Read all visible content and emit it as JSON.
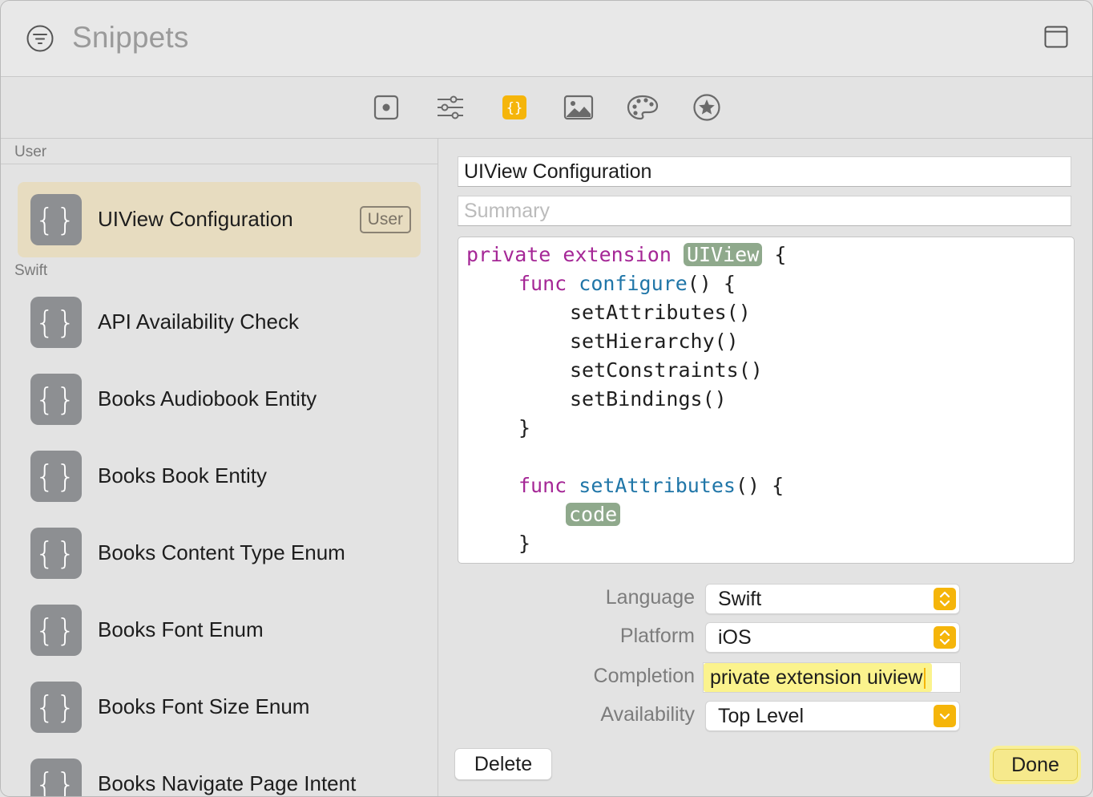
{
  "window": {
    "title": "Snippets"
  },
  "toolbar": {
    "tools": [
      {
        "icon": "record-icon",
        "active": false
      },
      {
        "icon": "sliders-icon",
        "active": false
      },
      {
        "icon": "braces-icon",
        "active": true
      },
      {
        "icon": "image-icon",
        "active": false
      },
      {
        "icon": "palette-icon",
        "active": false
      },
      {
        "icon": "star-icon",
        "active": false
      }
    ],
    "accent_color": "#f5b50a"
  },
  "sidebar": {
    "sections": [
      {
        "label": "User",
        "items": [
          {
            "label": "UIView Configuration",
            "badge": "User",
            "selected": true
          }
        ]
      },
      {
        "label": "Swift",
        "items": [
          {
            "label": "API Availability Check"
          },
          {
            "label": "Books Audiobook Entity"
          },
          {
            "label": "Books Book Entity"
          },
          {
            "label": "Books Content Type Enum"
          },
          {
            "label": "Books Font Enum"
          },
          {
            "label": "Books Font Size Enum"
          },
          {
            "label": "Books Navigate Page Intent"
          }
        ]
      }
    ],
    "icon_glyph": "{}",
    "selection_color": "#e7dcc0"
  },
  "detail": {
    "title_value": "UIView Configuration",
    "summary_placeholder": "Summary",
    "code": {
      "line1": {
        "kw1": "private",
        "kw2": "extension",
        "token": "UIView",
        "rest": " {"
      },
      "line2": {
        "kw": "func",
        "fn": "configure",
        "rest": "() {"
      },
      "line3": "setAttributes()",
      "line4": "setHierarchy()",
      "line5": "setConstraints()",
      "line6": "setBindings()",
      "line7": "}",
      "line9": {
        "kw": "func",
        "fn": "setAttributes",
        "rest": "() {"
      },
      "line10": {
        "token": "code"
      },
      "line11": "}"
    },
    "form": {
      "language_label": "Language",
      "language_value": "Swift",
      "platform_label": "Platform",
      "platform_value": "iOS",
      "completion_label": "Completion",
      "completion_value": "private extension uiview",
      "availability_label": "Availability",
      "availability_value": "Top Level"
    },
    "buttons": {
      "delete": "Delete",
      "done": "Done"
    }
  }
}
